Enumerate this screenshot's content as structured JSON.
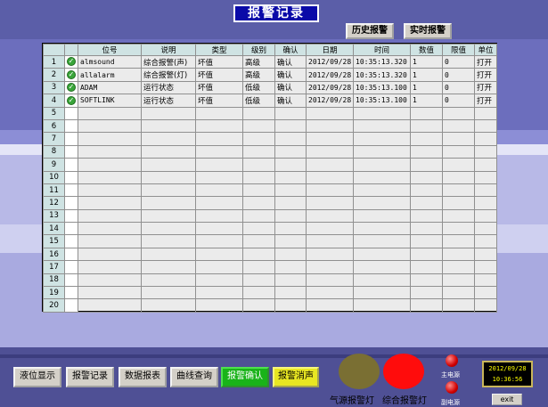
{
  "header": {
    "title": "报警记录",
    "history_button": "历史报警",
    "realtime_button": "实时报警"
  },
  "table": {
    "columns": [
      "",
      "",
      "位号",
      "说明",
      "类型",
      "级别",
      "确认",
      "日期",
      "时间",
      "数值",
      "限值",
      "单位"
    ],
    "rows": [
      {
        "num": "1",
        "icon": "check-icon",
        "tag": "almsound",
        "desc": "综合报警(声)",
        "type": "坏值",
        "level": "高级",
        "ack": "确认",
        "date": "2012/09/28",
        "time": "10:35:13.320",
        "value": "1",
        "limit": "0",
        "unit": "打开"
      },
      {
        "num": "2",
        "icon": "check-icon",
        "tag": "allalarm",
        "desc": "综合报警(灯)",
        "type": "坏值",
        "level": "高级",
        "ack": "确认",
        "date": "2012/09/28",
        "time": "10:35:13.320",
        "value": "1",
        "limit": "0",
        "unit": "打开"
      },
      {
        "num": "3",
        "icon": "check-icon",
        "tag": "ADAM",
        "desc": "运行状态",
        "type": "坏值",
        "level": "低级",
        "ack": "确认",
        "date": "2012/09/28",
        "time": "10:35:13.100",
        "value": "1",
        "limit": "0",
        "unit": "打开"
      },
      {
        "num": "4",
        "icon": "check-icon",
        "tag": "SOFTLINK",
        "desc": "运行状态",
        "type": "坏值",
        "level": "低级",
        "ack": "确认",
        "date": "2012/09/28",
        "time": "10:35:13.100",
        "value": "1",
        "limit": "0",
        "unit": "打开"
      },
      {
        "num": "5"
      },
      {
        "num": "6"
      },
      {
        "num": "7"
      },
      {
        "num": "8"
      },
      {
        "num": "9"
      },
      {
        "num": "10"
      },
      {
        "num": "11"
      },
      {
        "num": "12"
      },
      {
        "num": "13"
      },
      {
        "num": "14"
      },
      {
        "num": "15"
      },
      {
        "num": "16"
      },
      {
        "num": "17"
      },
      {
        "num": "18"
      },
      {
        "num": "19"
      },
      {
        "num": "20"
      }
    ]
  },
  "nav": {
    "level_display": "液位显示",
    "alarm_record": "报警记录",
    "data_report": "数据报表",
    "curve_query": "曲线查询",
    "alarm_ack": "报警确认",
    "alarm_silence": "报警消声"
  },
  "lamps": {
    "air_label": "气源报警灯",
    "general_label": "综合报警灯",
    "air_color": "#7a6f33",
    "general_color": "#ff0c0c"
  },
  "power": {
    "main_label": "主电源",
    "backup_label": "副电源"
  },
  "clock": {
    "date": "2012/09/28",
    "time": "10:36:56"
  },
  "exit_label": "exit"
}
